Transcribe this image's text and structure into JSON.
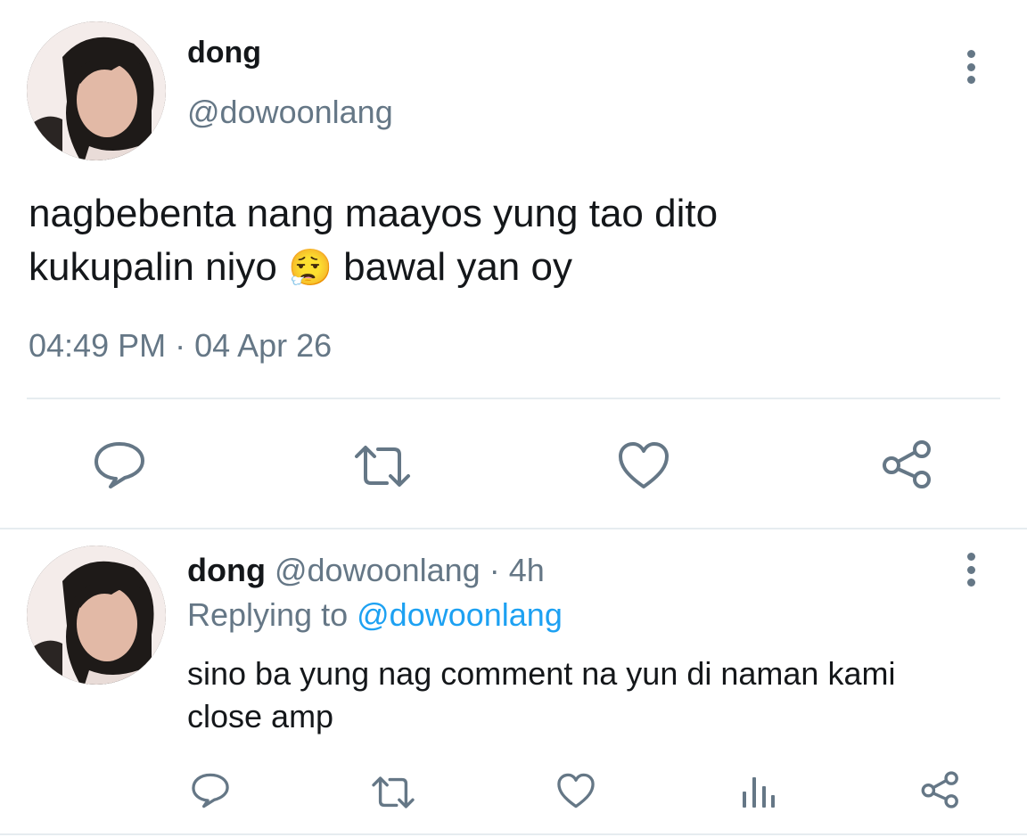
{
  "main_tweet": {
    "author_name": "dong",
    "author_handle": "@dowoonlang",
    "text_line1": "nagbebenta nang maayos yung tao dito",
    "text_line2_before": "kukupalin niyo",
    "emoji": "😮‍💨",
    "text_line2_after": "bawal yan oy",
    "timestamp": "04:49 PM · 04 Apr 26",
    "actions": [
      "reply-icon",
      "retweet-icon",
      "like-icon",
      "share-icon"
    ]
  },
  "reply": {
    "author_name": "dong",
    "author_handle": "@dowoonlang",
    "separator": "·",
    "time_ago": "4h",
    "replying_label": "Replying to",
    "replying_handle": "@dowoonlang",
    "text_line1": "sino ba yung nag comment na yun di naman kami",
    "text_line2": "close amp",
    "actions": [
      "reply-icon",
      "retweet-icon",
      "like-icon",
      "analytics-icon",
      "share-icon"
    ]
  },
  "colors": {
    "text": "#14171a",
    "muted": "#657786",
    "link": "#1da1f2",
    "divider": "#e6ecf0"
  }
}
